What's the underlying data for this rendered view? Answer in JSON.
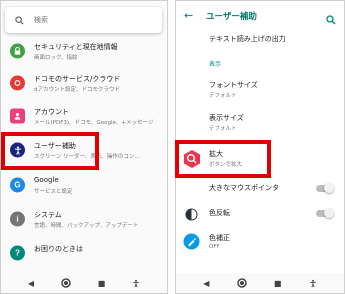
{
  "left": {
    "search_placeholder": "検索",
    "items": [
      {
        "title": "セキュリティと現在地情報",
        "subtitle": "画面ロック、指紋",
        "icon": "lock-icon",
        "color": "#43a047"
      },
      {
        "title": "ドコモのサービス/クラウド",
        "subtitle": "dアカウント設定、ドコモクラウド",
        "icon": "docomo-icon",
        "color": "#e53935"
      },
      {
        "title": "アカウント",
        "subtitle": "メール(PDF3)、ドコモ、Google、+メッセージ",
        "icon": "account-icon",
        "color": "#ec407a"
      },
      {
        "title": "ユーザー補助",
        "subtitle": "スクリーン リーダー、表示、操作のコン...",
        "icon": "accessibility-icon",
        "color": "#1a237e"
      },
      {
        "title": "Google",
        "subtitle": "サービスと設定",
        "icon": "google-icon",
        "color": "#1e88e5"
      },
      {
        "title": "システム",
        "subtitle": "言語、時間、バックアップ、アップデート",
        "icon": "info-icon",
        "color": "#757575"
      },
      {
        "title": "お困りのときは",
        "subtitle": "",
        "icon": "help-icon",
        "color": "#00897b"
      }
    ]
  },
  "right": {
    "title": "ユーザー補助",
    "items": [
      {
        "title": "テキスト読み上げの出力",
        "subtitle": ""
      },
      {
        "title": "表示",
        "subtitle": ""
      },
      {
        "title": "フォントサイズ",
        "subtitle": "デフォルト"
      },
      {
        "title": "表示サイズ",
        "subtitle": "デフォルト"
      },
      {
        "title": "拡大",
        "subtitle": "ボタンで拡大"
      },
      {
        "title": "大きなマウスポインタ",
        "subtitle": ""
      },
      {
        "title": "色反転",
        "subtitle": ""
      },
      {
        "title": "色補正",
        "subtitle": "OFF"
      }
    ]
  },
  "colors": {
    "accent": "#00897b",
    "highlight": "#e00000"
  }
}
